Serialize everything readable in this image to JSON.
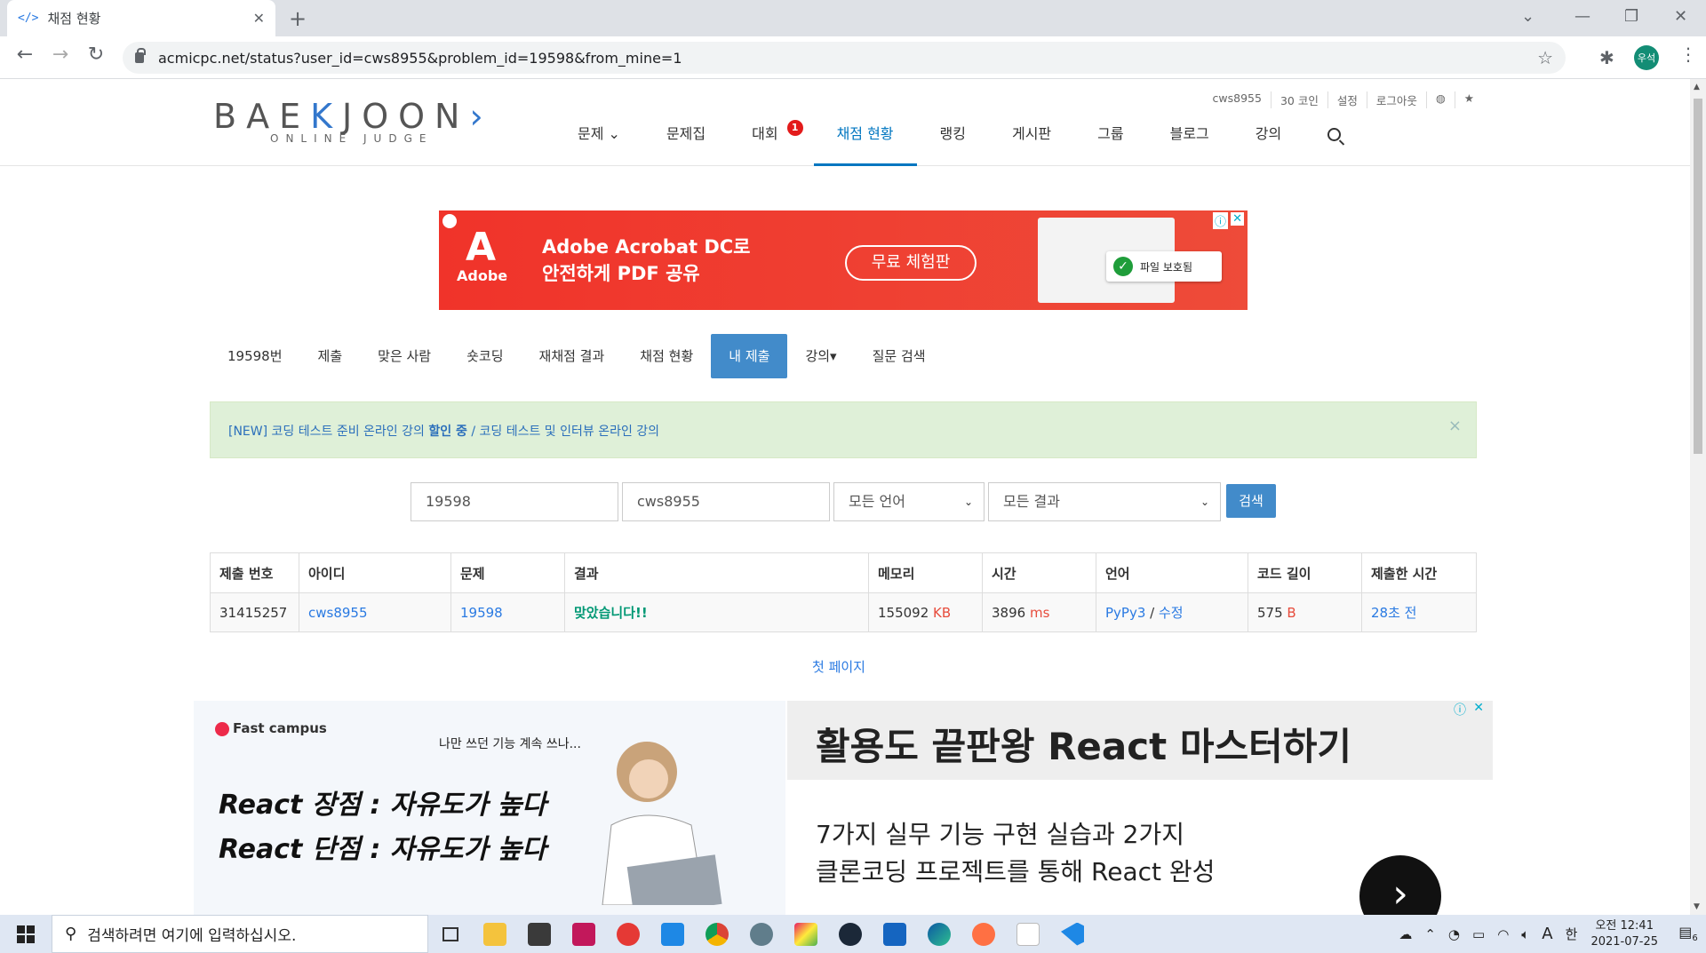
{
  "browser": {
    "tab_title": "채점 현황",
    "tab_favicon": "</>",
    "url": "acmicpc.net/status?user_id=cws8955&problem_id=19598&from_mine=1",
    "profile_label": "우석"
  },
  "site": {
    "logo_main": "BAE",
    "logo_k": "K",
    "logo_rest": "JOON",
    "logo_sub": "ONLINE JUDGE",
    "top_menu": [
      "cws8955",
      "30 코인",
      "설정",
      "로그아웃",
      "◍",
      "★"
    ],
    "nav": [
      {
        "label": "문제 ⌄",
        "active": false
      },
      {
        "label": "문제집",
        "active": false
      },
      {
        "label": "대회",
        "active": false,
        "badge": "1"
      },
      {
        "label": "채점 현황",
        "active": true
      },
      {
        "label": "랭킹",
        "active": false
      },
      {
        "label": "게시판",
        "active": false
      },
      {
        "label": "그룹",
        "active": false
      },
      {
        "label": "블로그",
        "active": false
      },
      {
        "label": "강의",
        "active": false
      }
    ]
  },
  "ad1": {
    "brand": "Adobe",
    "headline_line1": "Adobe Acrobat DC로",
    "headline_line2": "안전하게 PDF 공유",
    "cta": "무료 체험판",
    "toast": "파일 보호됨",
    "adinfo": "ⓘ",
    "close": "✕"
  },
  "problem_tabs": [
    {
      "label": "19598번",
      "active": false
    },
    {
      "label": "제출",
      "active": false
    },
    {
      "label": "맞은 사람",
      "active": false
    },
    {
      "label": "숏코딩",
      "active": false
    },
    {
      "label": "재채점 결과",
      "active": false
    },
    {
      "label": "채점 현황",
      "active": false
    },
    {
      "label": "내 제출",
      "active": true
    },
    {
      "label": "강의▾",
      "active": false
    },
    {
      "label": "질문 검색",
      "active": false
    }
  ],
  "alert": {
    "prefix": "[NEW] 코딩 테스트 준비 온라인 강의 ",
    "bold": "할인 중",
    "suffix": " / 코딩 테스트 및 인터뷰 온라인 강의",
    "close": "×"
  },
  "search": {
    "problem_id": "19598",
    "user_id": "cws8955",
    "language": "모든 언어",
    "result": "모든 결과",
    "button": "검색"
  },
  "table": {
    "headers": [
      "제출 번호",
      "아이디",
      "문제",
      "결과",
      "메모리",
      "시간",
      "언어",
      "코드 길이",
      "제출한 시간"
    ],
    "rows": [
      {
        "submission_id": "31415257",
        "user": "cws8955",
        "problem": "19598",
        "result": "맞았습니다!!",
        "memory": "155092",
        "memory_unit": "KB",
        "time": "3896",
        "time_unit": "ms",
        "language": "PyPy3",
        "edit": "수정",
        "code_length": "575",
        "code_unit": "B",
        "submitted": "28초 전"
      }
    ]
  },
  "first_page": "첫 페이지",
  "ad2": {
    "brand": "Fast campus",
    "quote": "나만 쓰던 기능 계속 쓰나...",
    "line1": "React 장점 : 자유도가 높다",
    "line2": "React 단점 : 자유도가 높다",
    "headline": "활용도 끝판왕 React 마스터하기",
    "desc_line1": "7가지 실무 기능 구현 실습과 2가지",
    "desc_line2": "클론코딩 프로젝트를 통해 React 완성",
    "arrow": "›",
    "adinfo": "ⓘ",
    "close": "✕"
  },
  "taskbar": {
    "search_placeholder": "검색하려면 여기에 입력하십시오.",
    "ime_lang": "A",
    "ime_mode": "한",
    "clock_time": "오전 12:41",
    "clock_date": "2021-07-25",
    "notifications": "6"
  },
  "colors": {
    "primary": "#428bca",
    "nav_active": "#0076c0",
    "link": "#2a7ae2",
    "accepted": "#009874",
    "unit_red": "#e74c3c",
    "alert_bg": "#dff0d8",
    "adobe_red": "#f0332a"
  }
}
